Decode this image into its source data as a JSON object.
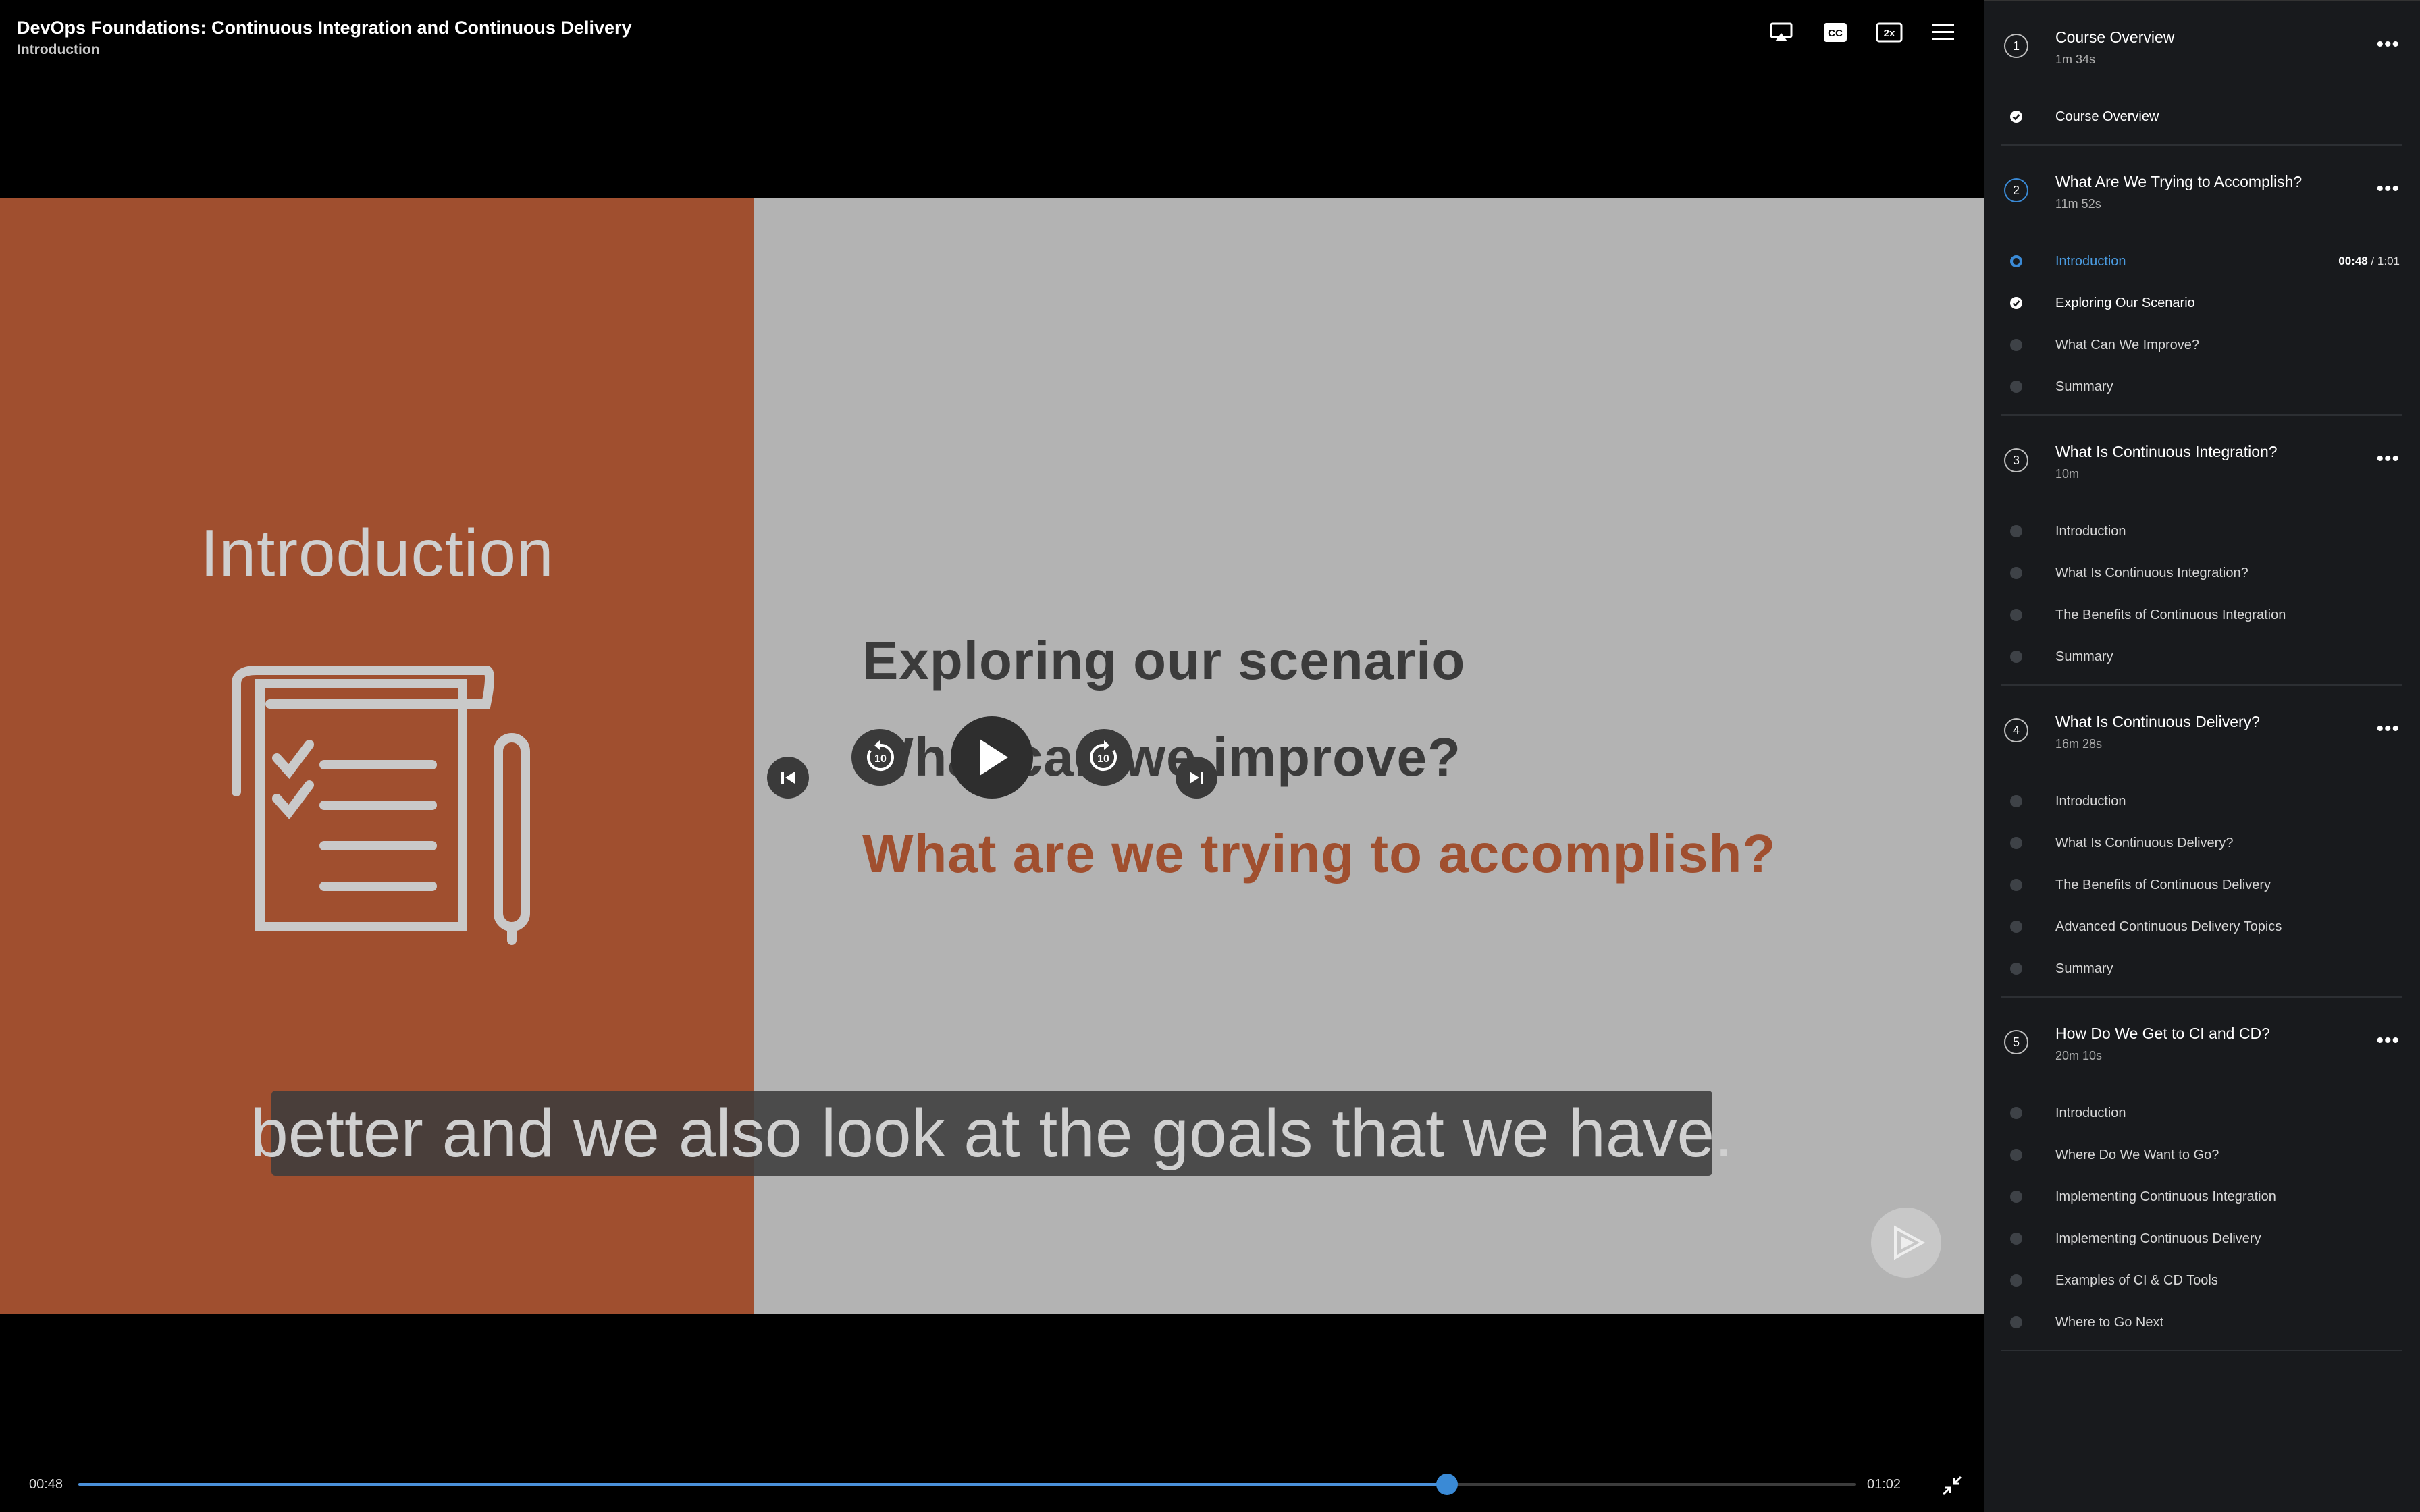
{
  "header": {
    "course_title": "DevOps Foundations: Continuous Integration and Continuous Delivery",
    "clip_title": "Introduction",
    "icons": [
      "airplay-icon",
      "closed-captions-icon",
      "speed-2x-icon",
      "menu-icon"
    ],
    "cc_label": "CC",
    "speed_label": "2x"
  },
  "video": {
    "intro_heading": "Introduction",
    "slide_lines": [
      "Exploring our scenario",
      "What can we improve?",
      "What are we trying to accomplish?"
    ],
    "caption": "better and we also look at the goals that we have.",
    "skip_back_label": "10",
    "skip_forward_label": "10",
    "accent_color": "#a04f2f"
  },
  "playback": {
    "current_time": "00:48",
    "total_time": "01:02",
    "progress_fraction": 0.77
  },
  "sidebar": {
    "modules": [
      {
        "num": "1",
        "title": "Course Overview",
        "duration": "1m 34s",
        "clips": [
          {
            "title": "Course Overview",
            "state": "done"
          }
        ]
      },
      {
        "num": "2",
        "title": "What Are We Trying to Accomplish?",
        "duration": "11m 52s",
        "active": true,
        "clips": [
          {
            "title": "Introduction",
            "state": "current",
            "time_cur": "00:48",
            "time_sep": " / ",
            "time_total": "1:01"
          },
          {
            "title": "Exploring Our Scenario",
            "state": "done"
          },
          {
            "title": "What Can We Improve?",
            "state": "todo"
          },
          {
            "title": "Summary",
            "state": "todo"
          }
        ]
      },
      {
        "num": "3",
        "title": "What Is Continuous Integration?",
        "duration": "10m",
        "clips": [
          {
            "title": "Introduction",
            "state": "todo"
          },
          {
            "title": "What Is Continuous Integration?",
            "state": "todo"
          },
          {
            "title": "The Benefits of Continuous Integration",
            "state": "todo"
          },
          {
            "title": "Summary",
            "state": "todo"
          }
        ]
      },
      {
        "num": "4",
        "title": "What Is Continuous Delivery?",
        "duration": "16m 28s",
        "clips": [
          {
            "title": "Introduction",
            "state": "todo"
          },
          {
            "title": "What Is Continuous Delivery?",
            "state": "todo"
          },
          {
            "title": "The Benefits of Continuous Delivery",
            "state": "todo"
          },
          {
            "title": "Advanced Continuous Delivery Topics",
            "state": "todo"
          },
          {
            "title": "Summary",
            "state": "todo"
          }
        ]
      },
      {
        "num": "5",
        "title": "How Do We Get to CI and CD?",
        "duration": "20m 10s",
        "clips": [
          {
            "title": "Introduction",
            "state": "todo"
          },
          {
            "title": "Where Do We Want to Go?",
            "state": "todo"
          },
          {
            "title": "Implementing Continuous Integration",
            "state": "todo"
          },
          {
            "title": "Implementing Continuous Delivery",
            "state": "todo"
          },
          {
            "title": "Examples of CI & CD Tools",
            "state": "todo"
          },
          {
            "title": "Where to Go Next",
            "state": "todo"
          }
        ]
      }
    ]
  }
}
